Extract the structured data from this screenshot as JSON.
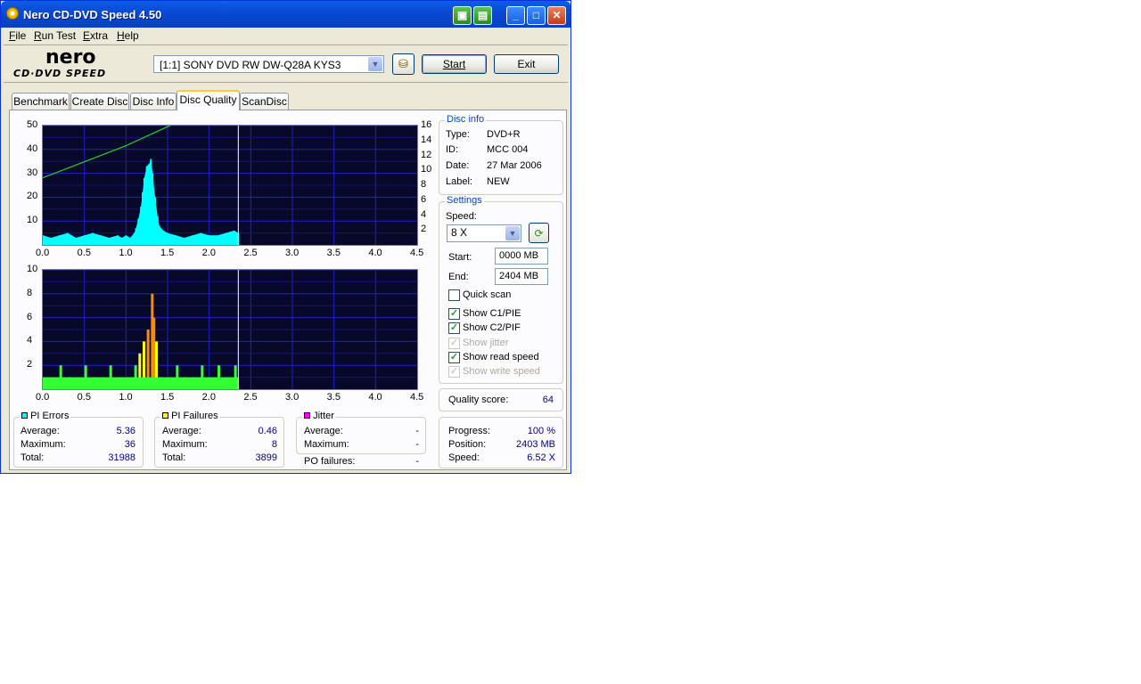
{
  "window": {
    "title": "Nero CD-DVD Speed 4.50"
  },
  "menu": [
    {
      "label": "File",
      "u": "F",
      "rest": "ile"
    },
    {
      "label": "Run Test",
      "u": "R",
      "rest": "un Test"
    },
    {
      "label": "Extra",
      "u": "E",
      "rest": "xtra"
    },
    {
      "label": "Help",
      "u": "H",
      "rest": "elp"
    }
  ],
  "logo": {
    "brand": "nero",
    "product": "CD·DVD SPEED"
  },
  "toolbar": {
    "drive": "[1:1]   SONY DVD RW DW-Q28A KYS3",
    "start_label": "Start",
    "exit_label": "Exit"
  },
  "tabs": [
    "Benchmark",
    "Create Disc",
    "Disc Info",
    "Disc Quality",
    "ScanDisc"
  ],
  "active_tab": "Disc Quality",
  "disc_info": {
    "title": "Disc info",
    "type_label": "Type:",
    "type": "DVD+R",
    "id_label": "ID:",
    "id": "MCC 004",
    "date_label": "Date:",
    "date": "27 Mar 2006",
    "label_label": "Label:",
    "label": "NEW"
  },
  "settings": {
    "title": "Settings",
    "speed_label": "Speed:",
    "speed": "8 X",
    "start_label": "Start:",
    "start": "0000 MB",
    "end_label": "End:",
    "end": "2404 MB",
    "checkboxes": [
      {
        "label": "Quick scan",
        "checked": false,
        "disabled": false
      },
      {
        "label": "Show C1/PIE",
        "checked": true,
        "disabled": false
      },
      {
        "label": "Show C2/PIF",
        "checked": true,
        "disabled": false
      },
      {
        "label": "Show jitter",
        "checked": true,
        "disabled": true
      },
      {
        "label": "Show read speed",
        "checked": true,
        "disabled": false
      },
      {
        "label": "Show write speed",
        "checked": true,
        "disabled": true
      }
    ]
  },
  "quality": {
    "label": "Quality score:",
    "value": "64"
  },
  "progress": {
    "progress_label": "Progress:",
    "progress": "100 %",
    "position_label": "Position:",
    "position": "2403 MB",
    "speed_label": "Speed:",
    "speed": "6.52 X"
  },
  "pi_errors": {
    "title": "PI Errors",
    "color": "#00ffff",
    "average_label": "Average:",
    "average": "5.36",
    "maximum_label": "Maximum:",
    "maximum": "36",
    "total_label": "Total:",
    "total": "31988"
  },
  "pi_failures": {
    "title": "PI Failures",
    "color": "#ffff00",
    "average_label": "Average:",
    "average": "0.46",
    "maximum_label": "Maximum:",
    "maximum": "8",
    "total_label": "Total:",
    "total": "3899"
  },
  "jitter": {
    "title": "Jitter",
    "color": "#ff00ff",
    "average_label": "Average:",
    "average": "-",
    "maximum_label": "Maximum:",
    "maximum": "-",
    "po_label": "PO failures:",
    "po": "-"
  },
  "chart_data": [
    {
      "type": "area",
      "name": "PI Errors graph",
      "x_ticks": [
        "0.0",
        "0.5",
        "1.0",
        "1.5",
        "2.0",
        "2.5",
        "3.0",
        "3.5",
        "4.0",
        "4.5"
      ],
      "y_ticks": [
        "10",
        "20",
        "30",
        "40",
        "50"
      ],
      "y2_ticks": [
        "2",
        "4",
        "6",
        "8",
        "10",
        "12",
        "14",
        "16"
      ],
      "xlim": [
        0,
        4.5
      ],
      "ylim": [
        0,
        50
      ],
      "y2lim": [
        0,
        16
      ],
      "scan_end": 2.35,
      "series": [
        {
          "color": "#00ffff",
          "x": [
            0.0,
            0.1,
            0.2,
            0.3,
            0.4,
            0.5,
            0.6,
            0.7,
            0.8,
            0.9,
            0.95,
            1.0,
            1.05,
            1.1,
            1.12,
            1.15,
            1.18,
            1.2,
            1.22,
            1.25,
            1.28,
            1.3,
            1.32,
            1.35,
            1.38,
            1.4,
            1.45,
            1.5,
            1.6,
            1.7,
            1.8,
            1.9,
            2.0,
            2.1,
            2.2,
            2.3,
            2.35
          ],
          "y": [
            4,
            3,
            4,
            5,
            3,
            4,
            5,
            4,
            3,
            4,
            3,
            4,
            3,
            5,
            7,
            11,
            16,
            22,
            28,
            33,
            34,
            36,
            30,
            20,
            12,
            8,
            6,
            5,
            4,
            3,
            4,
            5,
            4,
            4,
            5,
            6,
            5
          ]
        },
        {
          "color": "#22dd22",
          "name": "read speed",
          "x": [
            0.0,
            1.0,
            2.35
          ],
          "y": [
            9.0,
            13.3,
            20.2
          ]
        }
      ]
    },
    {
      "type": "bar",
      "name": "PI Failures graph",
      "x_ticks": [
        "0.0",
        "0.5",
        "1.0",
        "1.5",
        "2.0",
        "2.5",
        "3.0",
        "3.5",
        "4.0",
        "4.5"
      ],
      "y_ticks": [
        "2",
        "4",
        "6",
        "8",
        "10"
      ],
      "xlim": [
        0,
        4.5
      ],
      "ylim": [
        0,
        10
      ],
      "scan_end": 2.35,
      "series": [
        {
          "color": "#33ff33",
          "x": [
            0.0,
            0.1,
            0.2,
            0.3,
            0.4,
            0.5,
            0.6,
            0.7,
            0.8,
            0.9,
            1.0,
            1.05,
            1.1,
            1.15,
            1.2,
            1.25,
            1.3,
            1.32,
            1.35,
            1.4,
            1.5,
            1.6,
            1.7,
            1.8,
            1.9,
            2.0,
            2.1,
            2.2,
            2.3
          ],
          "y": [
            1,
            1,
            2,
            1,
            1,
            2,
            1,
            1,
            2,
            1,
            1,
            1,
            2,
            3,
            4,
            5,
            8,
            6,
            4,
            1,
            1,
            2,
            1,
            1,
            2,
            1,
            2,
            1,
            2
          ]
        }
      ]
    }
  ]
}
